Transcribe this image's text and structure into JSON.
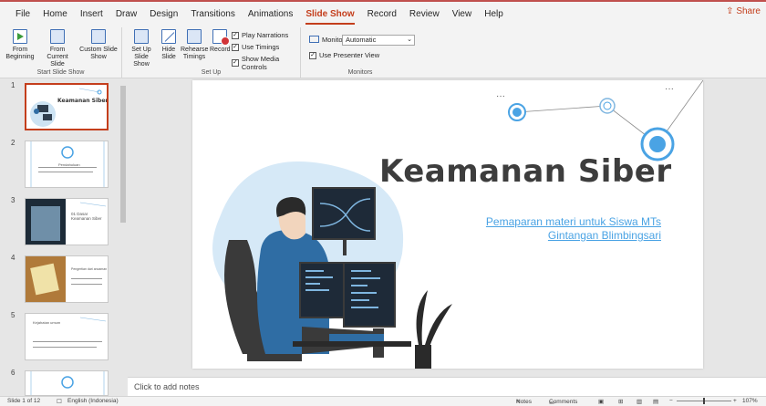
{
  "ribbon_tabs": [
    "File",
    "Home",
    "Insert",
    "Draw",
    "Design",
    "Transitions",
    "Animations",
    "Slide Show",
    "Record",
    "Review",
    "View",
    "Help"
  ],
  "active_tab": "Slide Show",
  "share_label": "Share",
  "groups": {
    "start_slide_show": {
      "label": "Start Slide Show",
      "from_beginning": "From Beginning",
      "from_current": "From Current Slide",
      "custom": "Custom Slide Show"
    },
    "set_up": {
      "label": "Set Up",
      "set_up_show": "Set Up Slide Show",
      "hide_slide": "Hide Slide",
      "rehearse": "Rehearse Timings",
      "record": "Record",
      "play_narrations": "Play Narrations",
      "use_timings": "Use Timings",
      "show_media_controls": "Show Media Controls"
    },
    "monitors": {
      "label": "Monitors",
      "monitor_label": "Monitor:",
      "monitor_value": "Automatic",
      "use_presenter_view": "Use Presenter View"
    }
  },
  "slides": [
    {
      "num": "1",
      "title": "Keamanan Siber"
    },
    {
      "num": "2",
      "title": "Pendahuluan"
    },
    {
      "num": "3",
      "title": "01 Dasar Keamanan Siber"
    },
    {
      "num": "4",
      "title": "Pengertian dari ancaman"
    },
    {
      "num": "5",
      "title": "Kejahatan umum"
    },
    {
      "num": "6",
      "title": ""
    }
  ],
  "main_slide": {
    "title": "Keamanan Siber",
    "subtitle_line1": "Pemaparan materi untuk Siswa MTs",
    "subtitle_line2": "Gintangan Blimbingsari"
  },
  "notes_placeholder": "Click to add notes",
  "status": {
    "slide_counter": "Slide 1 of 12",
    "language": "English (Indonesia)",
    "notes_label": "Notes",
    "comments_label": "Comments",
    "zoom": "107%"
  },
  "colors": {
    "accent": "#c43e1c",
    "link_blue": "#4aa3e4",
    "illustration_blue": "#2f6da4"
  }
}
